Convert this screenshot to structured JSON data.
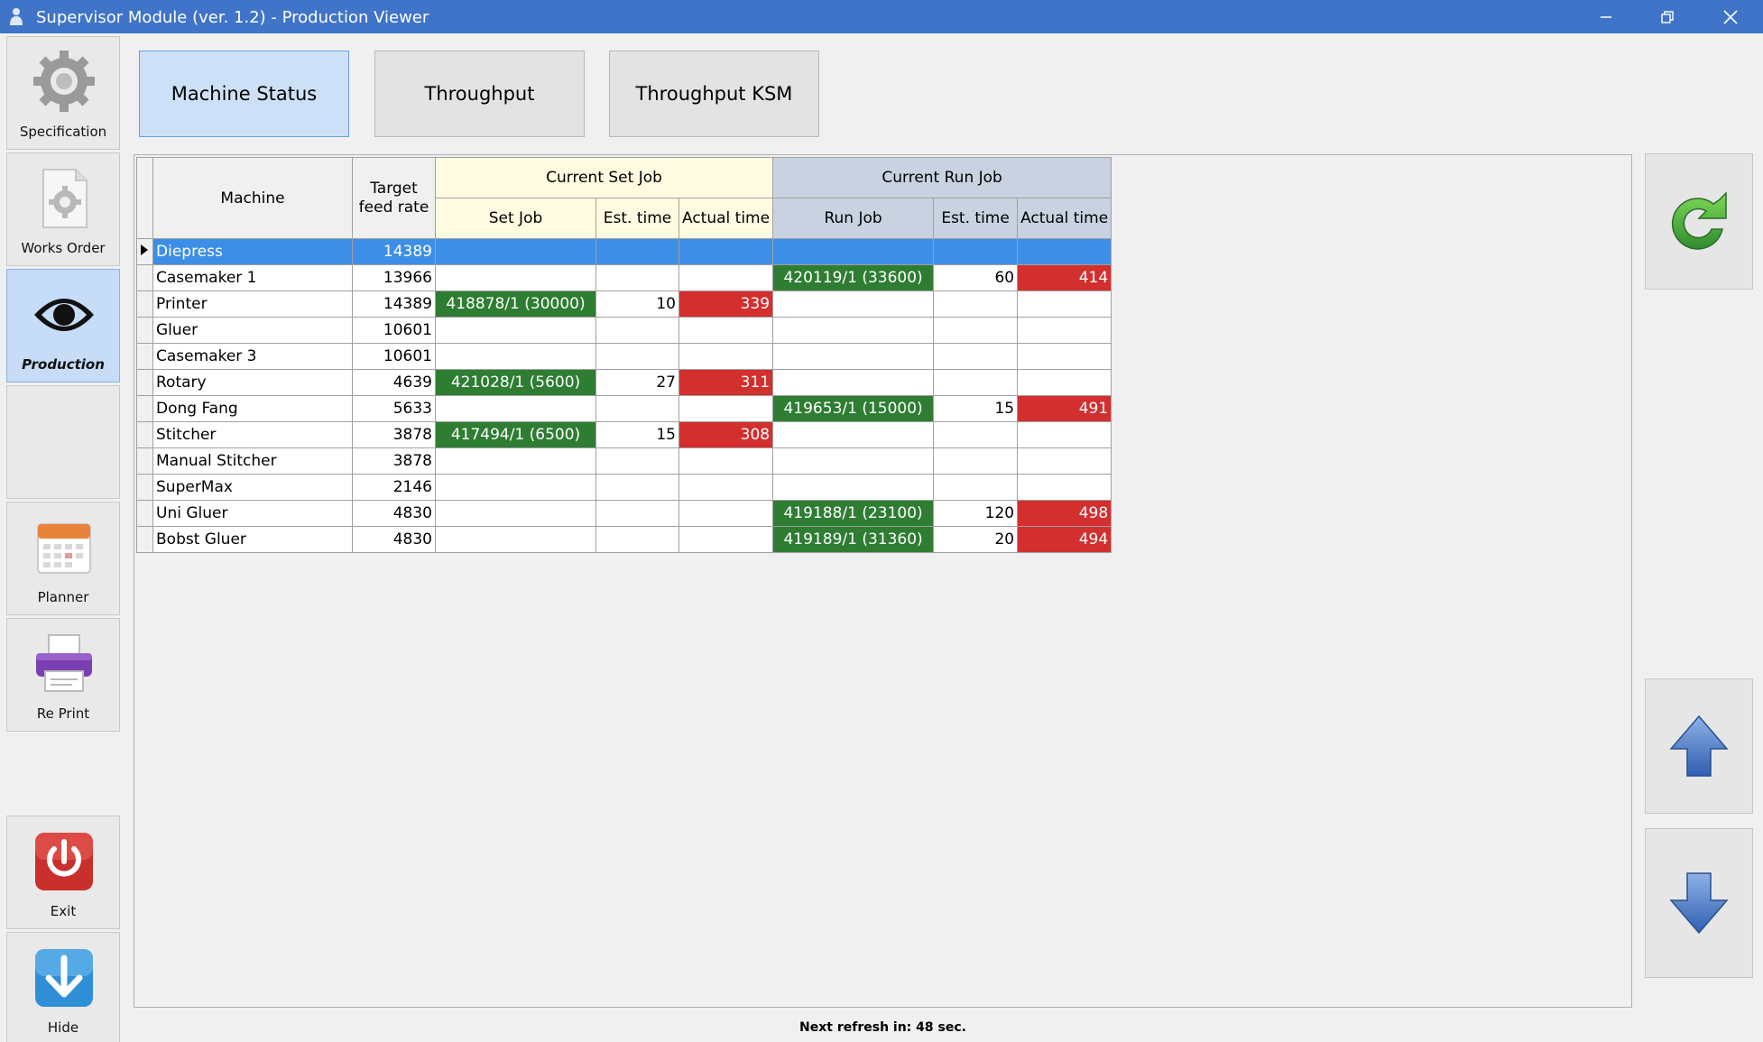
{
  "window": {
    "title": "Supervisor Module (ver. 1.2) - Production Viewer",
    "icons": {
      "app": "user-icon",
      "minimize": "minimize-icon",
      "restore": "restore-icon",
      "close": "close-icon"
    }
  },
  "nav": {
    "items": [
      {
        "label": "Specification",
        "icon": "gear-icon"
      },
      {
        "label": "Works Order",
        "icon": "document-gear-icon"
      },
      {
        "label": "Production",
        "icon": "eye-icon",
        "active": true
      },
      {
        "label": "",
        "icon": ""
      },
      {
        "label": "Planner",
        "icon": "calendar-icon"
      },
      {
        "label": "Re Print",
        "icon": "printer-icon"
      },
      {
        "label": "Exit",
        "icon": "power-icon"
      },
      {
        "label": "Hide",
        "icon": "arrow-down-icon"
      }
    ]
  },
  "tabs": [
    {
      "label": "Machine Status",
      "active": true
    },
    {
      "label": "Throughput"
    },
    {
      "label": "Throughput KSM"
    }
  ],
  "grid": {
    "headers": {
      "machine": "Machine",
      "target_feed_rate": "Target feed rate",
      "current_set_job": "Current Set Job",
      "current_run_job": "Current Run Job",
      "set_job": "Set Job",
      "set_est_time": "Est. time",
      "set_actual_time": "Actual time",
      "run_job": "Run Job",
      "run_est_time": "Est. time",
      "run_actual_time": "Actual time"
    },
    "rows": [
      {
        "machine": "Diepress",
        "rate": "14389",
        "set_job": "",
        "set_est": "",
        "set_act": "",
        "run_job": "",
        "run_est": "",
        "run_act": "",
        "selected": true
      },
      {
        "machine": "Casemaker 1",
        "rate": "13966",
        "set_job": "",
        "set_est": "",
        "set_act": "",
        "run_job": "420119/1 (33600)",
        "run_est": "60",
        "run_act": "414"
      },
      {
        "machine": "Printer",
        "rate": "14389",
        "set_job": "418878/1 (30000)",
        "set_est": "10",
        "set_act": "339",
        "run_job": "",
        "run_est": "",
        "run_act": ""
      },
      {
        "machine": "Gluer",
        "rate": "10601",
        "set_job": "",
        "set_est": "",
        "set_act": "",
        "run_job": "",
        "run_est": "",
        "run_act": ""
      },
      {
        "machine": "Casemaker 3",
        "rate": "10601",
        "set_job": "",
        "set_est": "",
        "set_act": "",
        "run_job": "",
        "run_est": "",
        "run_act": ""
      },
      {
        "machine": "Rotary",
        "rate": "4639",
        "set_job": "421028/1 (5600)",
        "set_est": "27",
        "set_act": "311",
        "run_job": "",
        "run_est": "",
        "run_act": ""
      },
      {
        "machine": "Dong Fang",
        "rate": "5633",
        "set_job": "",
        "set_est": "",
        "set_act": "",
        "run_job": "419653/1 (15000)",
        "run_est": "15",
        "run_act": "491"
      },
      {
        "machine": "Stitcher",
        "rate": "3878",
        "set_job": "417494/1 (6500)",
        "set_est": "15",
        "set_act": "308",
        "run_job": "",
        "run_est": "",
        "run_act": ""
      },
      {
        "machine": "Manual Stitcher",
        "rate": "3878",
        "set_job": "",
        "set_est": "",
        "set_act": "",
        "run_job": "",
        "run_est": "",
        "run_act": ""
      },
      {
        "machine": "SuperMax",
        "rate": "2146",
        "set_job": "",
        "set_est": "",
        "set_act": "",
        "run_job": "",
        "run_est": "",
        "run_act": ""
      },
      {
        "machine": "Uni Gluer",
        "rate": "4830",
        "set_job": "",
        "set_est": "",
        "set_act": "",
        "run_job": "419188/1 (23100)",
        "run_est": "120",
        "run_act": "498"
      },
      {
        "machine": "Bobst Gluer",
        "rate": "4830",
        "set_job": "",
        "set_est": "",
        "set_act": "",
        "run_job": "419189/1 (31360)",
        "run_est": "20",
        "run_act": "494"
      }
    ]
  },
  "side": {
    "refresh_icon": "refresh-icon",
    "up_icon": "arrow-up-icon",
    "down_icon": "arrow-down-icon"
  },
  "footer": {
    "refresh_text": "Next refresh in: 48 sec."
  },
  "colors": {
    "titlebar": "#3f74c8",
    "selected_row": "#3d8ee6",
    "job_green": "#2e7d32",
    "overdue_red": "#d32f2f"
  }
}
